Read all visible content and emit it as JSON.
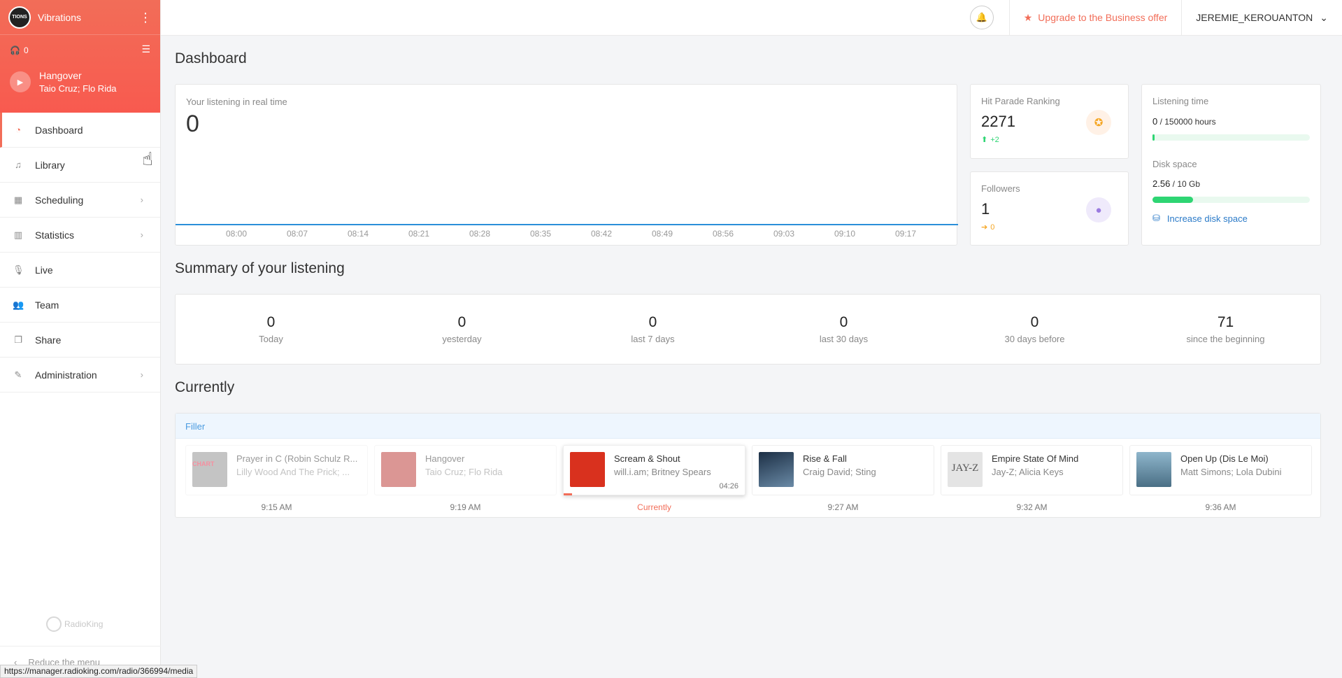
{
  "sidebar": {
    "logo_text": "TIONS",
    "radio_name": "Vibrations",
    "listeners": "0",
    "now_playing": {
      "title": "Hangover",
      "artist": "Taio Cruz; Flo Rida"
    },
    "items": [
      {
        "label": "Dashboard",
        "icon": "dashboard-icon",
        "active": true
      },
      {
        "label": "Library",
        "icon": "music-note-icon"
      },
      {
        "label": "Scheduling",
        "icon": "calendar-icon",
        "chevron": true
      },
      {
        "label": "Statistics",
        "icon": "bar-chart-icon",
        "chevron": true
      },
      {
        "label": "Live",
        "icon": "microphone-icon"
      },
      {
        "label": "Team",
        "icon": "users-icon"
      },
      {
        "label": "Share",
        "icon": "share-icon"
      },
      {
        "label": "Administration",
        "icon": "wrench-icon",
        "chevron": true
      }
    ],
    "brand": "RadioKing",
    "reduce_label": "Reduce the menu"
  },
  "statusbar_url": "https://manager.radioking.com/radio/366994/media",
  "header": {
    "upgrade_label": "Upgrade to the Business offer",
    "username": "JEREMIE_KEROUANTON"
  },
  "dashboard": {
    "title": "Dashboard",
    "realtime": {
      "title": "Your listening in real time",
      "value": "0"
    },
    "hit_parade": {
      "title": "Hit Parade Ranking",
      "value": "2271",
      "delta": "+2"
    },
    "followers": {
      "title": "Followers",
      "value": "1",
      "delta": "0"
    },
    "usage": {
      "listening_title": "Listening time",
      "listening_used": "0",
      "listening_total": " / 150000 hours",
      "listening_fraction": 0.0,
      "disk_title": "Disk space",
      "disk_used": "2.56",
      "disk_total": " / 10 Gb",
      "disk_fraction": 0.256,
      "increase_label": "Increase disk space"
    }
  },
  "summary": {
    "title": "Summary of your listening",
    "items": [
      {
        "value": "0",
        "label": "Today"
      },
      {
        "value": "0",
        "label": "yesterday"
      },
      {
        "value": "0",
        "label": "last 7 days"
      },
      {
        "value": "0",
        "label": "last 30 days"
      },
      {
        "value": "0",
        "label": "30 days before"
      },
      {
        "value": "71",
        "label": "since the beginning"
      }
    ]
  },
  "currently": {
    "title": "Currently",
    "playlist": "Filler",
    "tracks": [
      {
        "title": "Prayer in C (Robin Schulz R...",
        "artist": "Lilly Wood And The Prick; ...",
        "time": "9:15 AM",
        "state": "past",
        "art": "#8a8a8a",
        "art_label": "CHART"
      },
      {
        "title": "Hangover",
        "artist": "Taio Cruz; Flo Rida",
        "time": "9:19 AM",
        "state": "past",
        "art": "#b9302c",
        "art_label": ""
      },
      {
        "title": "Scream & Shout",
        "artist": "will.i.am; Britney Spears",
        "time": "Currently",
        "duration": "04:26",
        "state": "current",
        "art": "#d9311e",
        "art_label": ""
      },
      {
        "title": "Rise & Fall",
        "artist": "Craig David; Sting",
        "time": "9:27 AM",
        "state": "next",
        "art": "#2d4660",
        "art_label": ""
      },
      {
        "title": "Empire State Of Mind",
        "artist": "Jay-Z; Alicia Keys",
        "time": "9:32 AM",
        "state": "next",
        "art": "#e4e4e4",
        "art_label": "JAY-Z"
      },
      {
        "title": "Open Up (Dis Le Moi)",
        "artist": "Matt Simons; Lola Dubini",
        "time": "9:36 AM",
        "state": "next",
        "art": "#5a7d92",
        "art_label": ""
      }
    ]
  },
  "chart_data": {
    "type": "line",
    "x": [
      "08:00",
      "08:07",
      "08:14",
      "08:21",
      "08:28",
      "08:35",
      "08:42",
      "08:49",
      "08:56",
      "09:03",
      "09:10",
      "09:17"
    ],
    "series": [
      {
        "values": [
          0,
          0,
          0,
          0,
          0,
          0,
          0,
          0,
          0,
          0,
          0,
          0
        ]
      }
    ],
    "title": "Your listening in real time",
    "color": "#2b8fd9",
    "grid": false
  }
}
